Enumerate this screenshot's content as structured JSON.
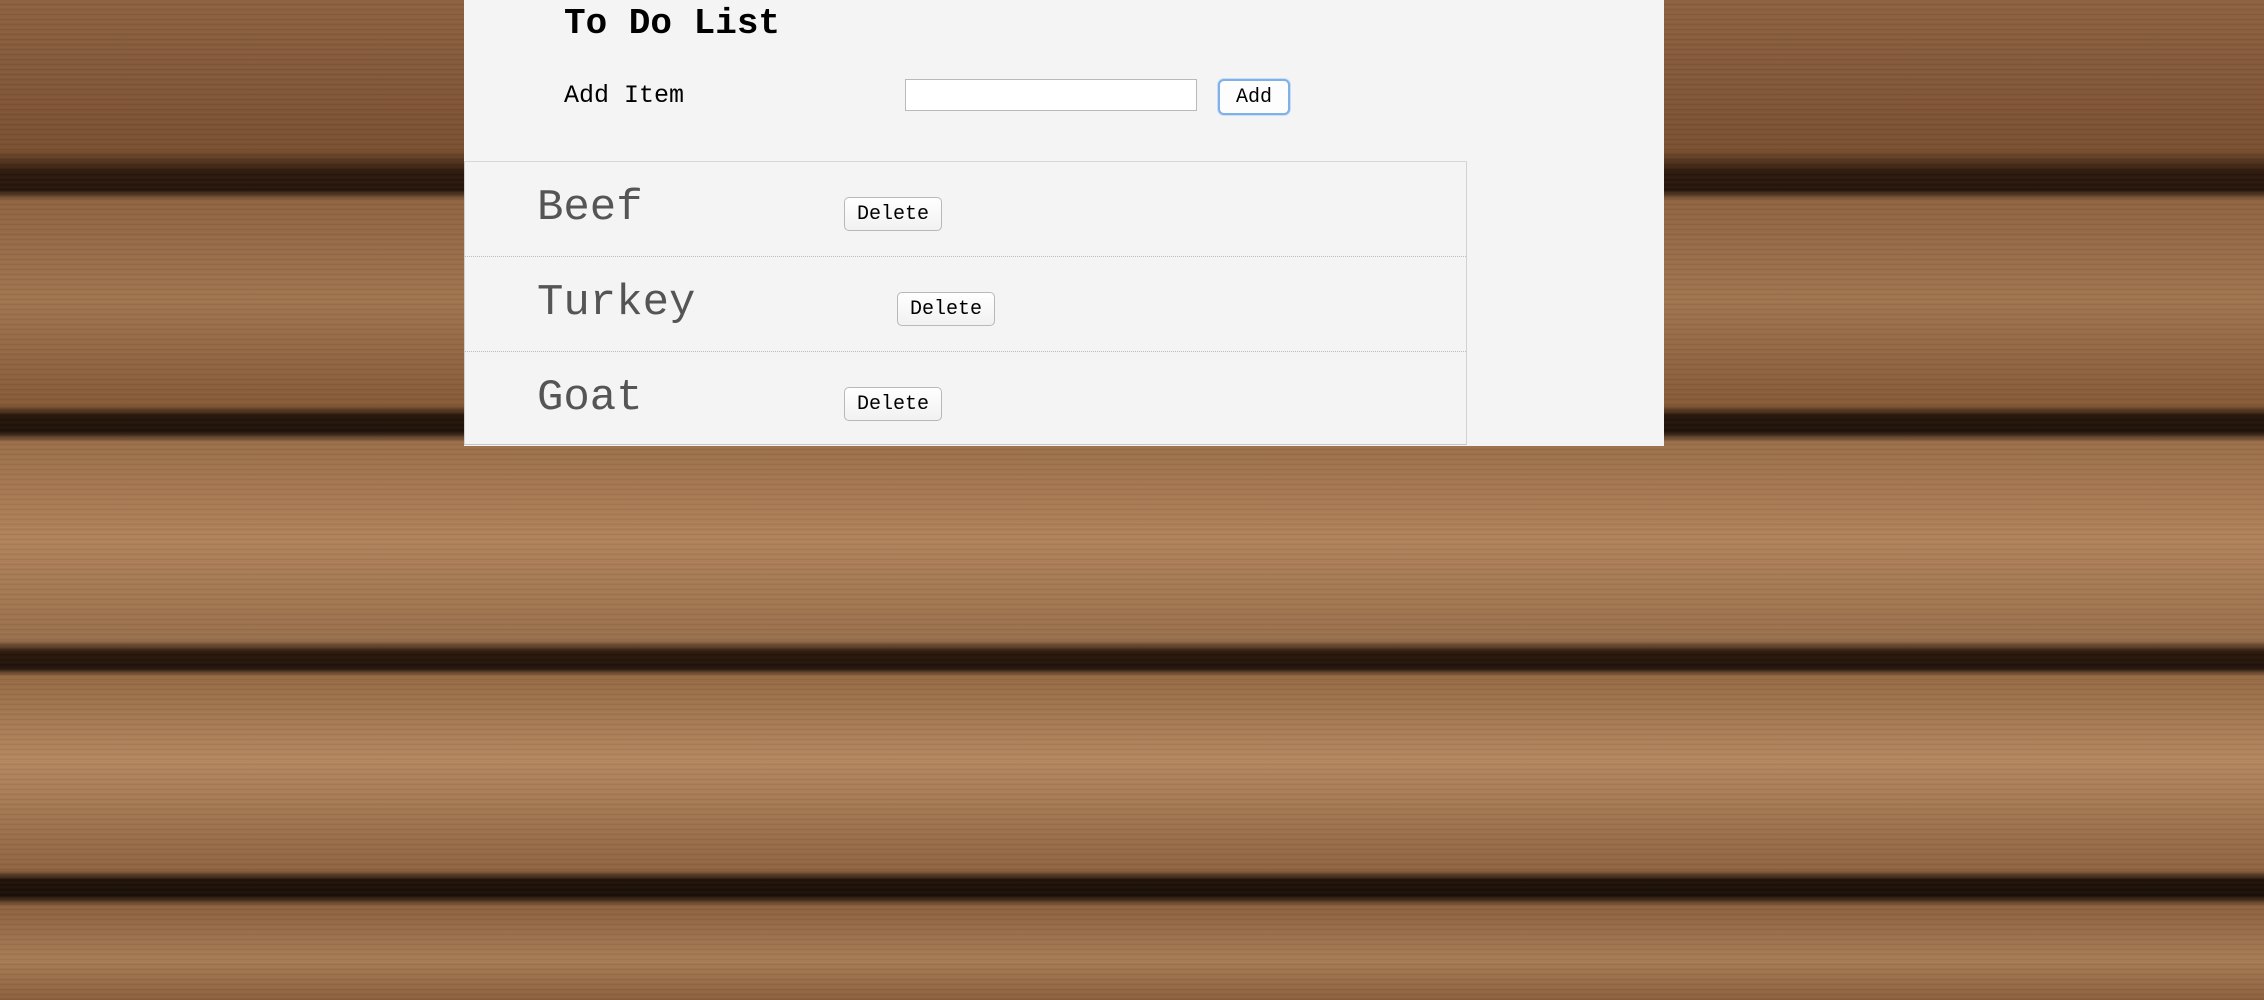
{
  "app": {
    "title": "To Do List"
  },
  "add_form": {
    "label": "Add Item",
    "input_value": "",
    "input_placeholder": "",
    "button_label": "Add"
  },
  "items": [
    {
      "text": "Beef",
      "delete_label": "Delete"
    },
    {
      "text": "Turkey",
      "delete_label": "Delete"
    },
    {
      "text": "Goat",
      "delete_label": "Delete"
    }
  ]
}
